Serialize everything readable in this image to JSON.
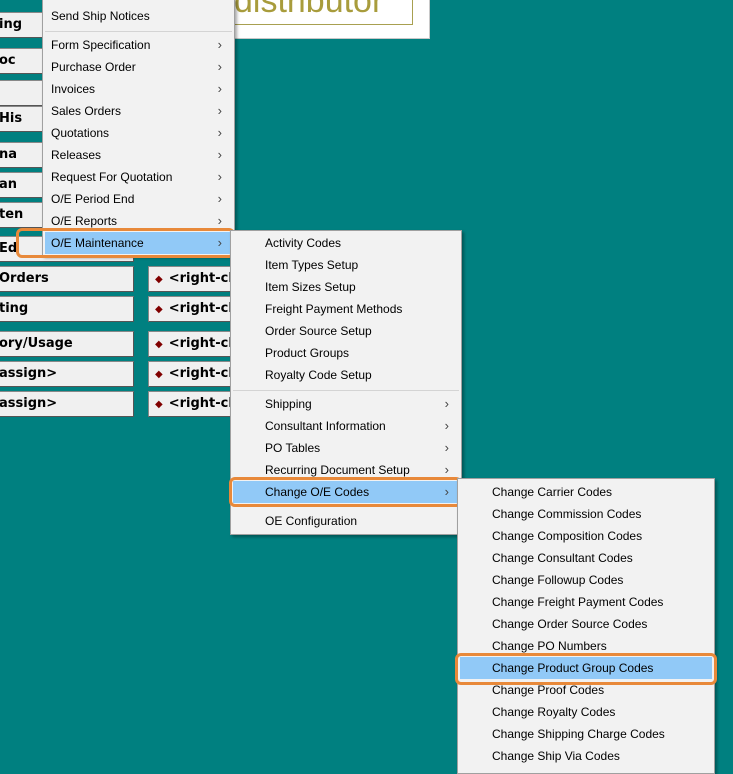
{
  "logo_text": "distributor",
  "bg_buttons": {
    "left": [
      "ing",
      "oc",
      "",
      "His",
      "na",
      "an",
      "ten",
      "Ed",
      "Orders",
      "ting",
      "ory/Usage",
      "assign>",
      "assign>"
    ],
    "right": [
      "<right-clic",
      "<right-clic",
      "<right-clic",
      "<right-clic",
      "<right-clic"
    ]
  },
  "menu1": {
    "items": [
      {
        "label": "Send Ship Notices",
        "submenu": false
      },
      {
        "label": "Form Specification",
        "submenu": true
      },
      {
        "label": "Purchase Order",
        "submenu": true
      },
      {
        "label": "Invoices",
        "submenu": true
      },
      {
        "label": "Sales Orders",
        "submenu": true
      },
      {
        "label": "Quotations",
        "submenu": true
      },
      {
        "label": "Releases",
        "submenu": true
      },
      {
        "label": "Request For Quotation",
        "submenu": true
      },
      {
        "label": "O/E Period End",
        "submenu": true
      },
      {
        "label": "O/E Reports",
        "submenu": true
      },
      {
        "label": "O/E Maintenance",
        "submenu": true,
        "highlighted": true
      }
    ]
  },
  "menu2": {
    "items": [
      {
        "label": "Activity Codes",
        "submenu": false
      },
      {
        "label": "Item Types Setup",
        "submenu": false
      },
      {
        "label": "Item Sizes Setup",
        "submenu": false
      },
      {
        "label": "Freight Payment Methods",
        "submenu": false
      },
      {
        "label": "Order Source Setup",
        "submenu": false
      },
      {
        "label": "Product Groups",
        "submenu": false
      },
      {
        "label": "Royalty Code Setup",
        "submenu": false
      },
      {
        "label": "Shipping",
        "submenu": true
      },
      {
        "label": "Consultant Information",
        "submenu": true
      },
      {
        "label": "PO Tables",
        "submenu": true
      },
      {
        "label": "Recurring Document Setup",
        "submenu": true
      },
      {
        "label": "Change O/E Codes",
        "submenu": true,
        "highlighted": true
      },
      {
        "label": "OE Configuration",
        "submenu": false
      }
    ]
  },
  "menu3": {
    "items": [
      {
        "label": "Change Carrier Codes"
      },
      {
        "label": "Change Commission Codes"
      },
      {
        "label": "Change Composition Codes"
      },
      {
        "label": "Change Consultant Codes"
      },
      {
        "label": "Change Followup Codes"
      },
      {
        "label": "Change Freight Payment Codes"
      },
      {
        "label": "Change Order Source Codes"
      },
      {
        "label": "Change PO Numbers"
      },
      {
        "label": "Change Product Group Codes",
        "highlighted": true
      },
      {
        "label": "Change Proof Codes"
      },
      {
        "label": "Change Royalty Codes"
      },
      {
        "label": "Change Shipping Charge Codes"
      },
      {
        "label": "Change Ship Via Codes"
      }
    ]
  },
  "colors": {
    "background": "#008080",
    "highlight": "#91c9f7",
    "callout": "#e8893a"
  }
}
